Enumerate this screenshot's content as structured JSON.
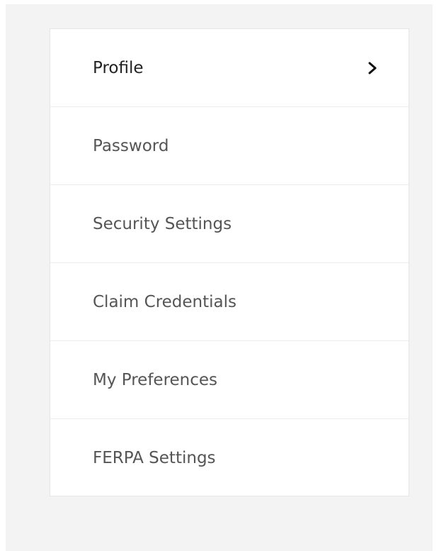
{
  "menu": {
    "items": [
      {
        "label": "Profile",
        "active": true,
        "icon": "chevron-right-icon"
      },
      {
        "label": "Password",
        "active": false
      },
      {
        "label": "Security Settings",
        "active": false
      },
      {
        "label": "Claim Credentials",
        "active": false
      },
      {
        "label": "My Preferences",
        "active": false
      },
      {
        "label": "FERPA Settings",
        "active": false
      }
    ]
  },
  "colors": {
    "background": "#f3f3f3",
    "card": "#ffffff",
    "divider": "#ececec",
    "text": "#555555",
    "active_text": "#222222"
  }
}
